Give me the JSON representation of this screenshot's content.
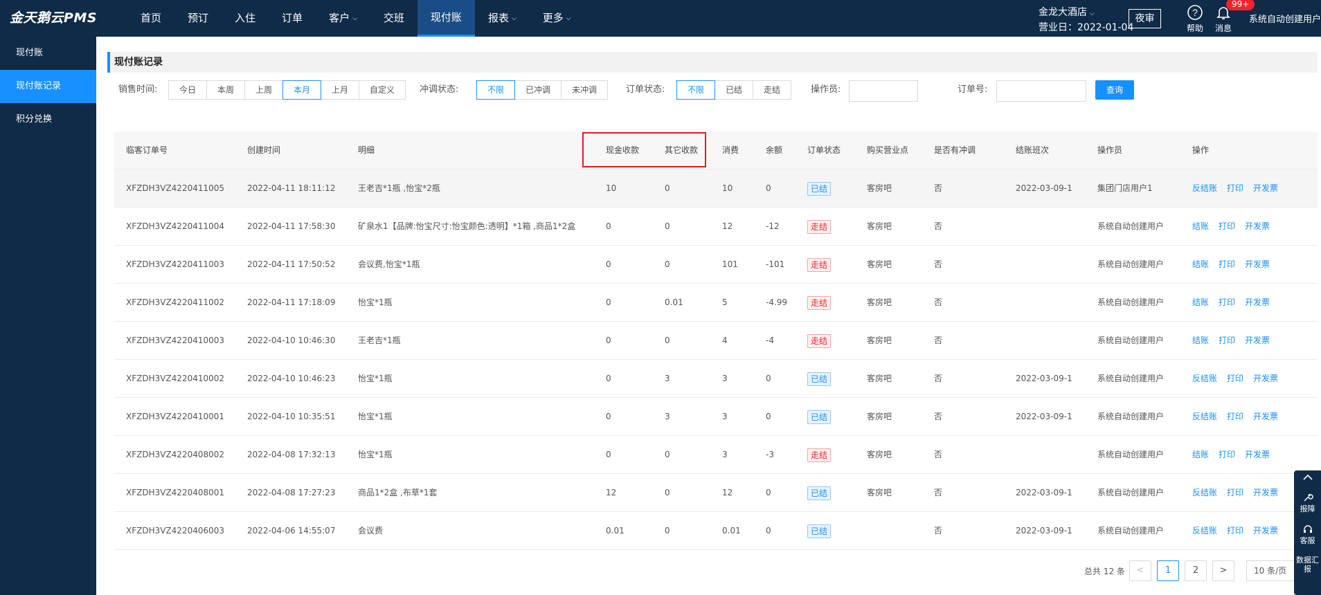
{
  "app": {
    "logo": "金天鹅云PMS",
    "nav": [
      {
        "label": "首页",
        "dropdown": false
      },
      {
        "label": "预订",
        "dropdown": false
      },
      {
        "label": "入住",
        "dropdown": false
      },
      {
        "label": "订单",
        "dropdown": false
      },
      {
        "label": "客户",
        "dropdown": true
      },
      {
        "label": "交班",
        "dropdown": false
      },
      {
        "label": "现付账",
        "dropdown": false,
        "active": true
      },
      {
        "label": "报表",
        "dropdown": true
      },
      {
        "label": "更多",
        "dropdown": true
      }
    ],
    "hotel_name": "金龙大酒店",
    "business_day": "营业日：2022-01-04",
    "night_audit": "夜审",
    "help_label": "帮助",
    "msg_label": "消息",
    "msg_badge": "99+",
    "user_name": "系统自动创建用户"
  },
  "sidebar": {
    "items": [
      {
        "label": "现付账",
        "active": false
      },
      {
        "label": "现付账记录",
        "active": true
      },
      {
        "label": "积分兑换",
        "active": false
      }
    ]
  },
  "page": {
    "title": "现付账记录",
    "filters": {
      "sale_time_label": "销售时间:",
      "sale_time_options": [
        "今日",
        "本周",
        "上周",
        "本月",
        "上月",
        "自定义"
      ],
      "sale_time_selected": "本月",
      "adjust_label": "冲调状态:",
      "adjust_options": [
        "不限",
        "已冲调",
        "未冲调"
      ],
      "adjust_selected": "不限",
      "order_status_label": "订单状态:",
      "order_status_options": [
        "不限",
        "已结",
        "走结"
      ],
      "order_status_selected": "不限",
      "operator_label": "操作员:",
      "operator_value": "",
      "order_no_label": "订单号:",
      "order_no_value": "",
      "query_button": "查询"
    },
    "table": {
      "headers": [
        "临客订单号",
        "创建时间",
        "明细",
        "现金收款",
        "其它收款",
        "消费",
        "余额",
        "订单状态",
        "购买营业点",
        "是否有冲调",
        "结账班次",
        "操作员",
        "操作"
      ],
      "rows": [
        {
          "order_no": "XFZDH3VZ4220411005",
          "created": "2022-04-11 18:11:12",
          "detail": "王老吉*1瓶 ,怡宝*2瓶",
          "cash": "10",
          "other": "0",
          "consume": "10",
          "balance": "0",
          "status": "已结",
          "status_type": "done",
          "point": "客房吧",
          "adjusted": "否",
          "shift": "2022-03-09-1",
          "operator": "集团门店用户1",
          "actions": [
            "反结账",
            "打印",
            "开发票"
          ]
        },
        {
          "order_no": "XFZDH3VZ4220411004",
          "created": "2022-04-11 17:58:30",
          "detail": "矿泉水1【品牌:怡宝尺寸:怡宝颜色:透明】*1箱 ,商品1*2盒",
          "cash": "0",
          "other": "0",
          "consume": "12",
          "balance": "-12",
          "status": "走结",
          "status_type": "skip",
          "point": "客房吧",
          "adjusted": "否",
          "shift": "",
          "operator": "系统自动创建用户",
          "actions": [
            "结账",
            "打印",
            "开发票"
          ]
        },
        {
          "order_no": "XFZDH3VZ4220411003",
          "created": "2022-04-11 17:50:52",
          "detail": "会议费,怡宝*1瓶",
          "cash": "0",
          "other": "0",
          "consume": "101",
          "balance": "-101",
          "status": "走结",
          "status_type": "skip",
          "point": "客房吧",
          "adjusted": "否",
          "shift": "",
          "operator": "系统自动创建用户",
          "actions": [
            "结账",
            "打印",
            "开发票"
          ]
        },
        {
          "order_no": "XFZDH3VZ4220411002",
          "created": "2022-04-11 17:18:09",
          "detail": "怡宝*1瓶",
          "cash": "0",
          "other": "0.01",
          "consume": "5",
          "balance": "-4.99",
          "status": "走结",
          "status_type": "skip",
          "point": "客房吧",
          "adjusted": "否",
          "shift": "",
          "operator": "系统自动创建用户",
          "actions": [
            "结账",
            "打印",
            "开发票"
          ]
        },
        {
          "order_no": "XFZDH3VZ4220410003",
          "created": "2022-04-10 10:46:30",
          "detail": "王老吉*1瓶",
          "cash": "0",
          "other": "0",
          "consume": "4",
          "balance": "-4",
          "status": "走结",
          "status_type": "skip",
          "point": "客房吧",
          "adjusted": "否",
          "shift": "",
          "operator": "系统自动创建用户",
          "actions": [
            "结账",
            "打印",
            "开发票"
          ]
        },
        {
          "order_no": "XFZDH3VZ4220410002",
          "created": "2022-04-10 10:46:23",
          "detail": "怡宝*1瓶",
          "cash": "0",
          "other": "3",
          "consume": "3",
          "balance": "0",
          "status": "已结",
          "status_type": "done",
          "point": "客房吧",
          "adjusted": "否",
          "shift": "2022-03-09-1",
          "operator": "系统自动创建用户",
          "actions": [
            "反结账",
            "打印",
            "开发票"
          ]
        },
        {
          "order_no": "XFZDH3VZ4220410001",
          "created": "2022-04-10 10:35:51",
          "detail": "怡宝*1瓶",
          "cash": "0",
          "other": "3",
          "consume": "3",
          "balance": "0",
          "status": "已结",
          "status_type": "done",
          "point": "客房吧",
          "adjusted": "否",
          "shift": "2022-03-09-1",
          "operator": "系统自动创建用户",
          "actions": [
            "反结账",
            "打印",
            "开发票"
          ]
        },
        {
          "order_no": "XFZDH3VZ4220408002",
          "created": "2022-04-08 17:32:13",
          "detail": "怡宝*1瓶",
          "cash": "0",
          "other": "0",
          "consume": "3",
          "balance": "-3",
          "status": "走结",
          "status_type": "skip",
          "point": "客房吧",
          "adjusted": "否",
          "shift": "",
          "operator": "系统自动创建用户",
          "actions": [
            "结账",
            "打印",
            "开发票"
          ]
        },
        {
          "order_no": "XFZDH3VZ4220408001",
          "created": "2022-04-08 17:27:23",
          "detail": "商品1*2盒 ,布草*1套",
          "cash": "12",
          "other": "0",
          "consume": "12",
          "balance": "0",
          "status": "已结",
          "status_type": "done",
          "point": "客房吧",
          "adjusted": "否",
          "shift": "2022-03-09-1",
          "operator": "系统自动创建用户",
          "actions": [
            "反结账",
            "打印",
            "开发票"
          ]
        },
        {
          "order_no": "XFZDH3VZ4220406003",
          "created": "2022-04-06 14:55:07",
          "detail": "会议费",
          "cash": "0.01",
          "other": "0",
          "consume": "0.01",
          "balance": "0",
          "status": "已结",
          "status_type": "done",
          "point": "",
          "adjusted": "否",
          "shift": "2022-03-09-1",
          "operator": "系统自动创建用户",
          "actions": [
            "反结账",
            "打印",
            "开发票"
          ]
        }
      ]
    },
    "pager": {
      "total": "总共 12 条",
      "prev": "<",
      "pages": [
        "1",
        "2"
      ],
      "current": "1",
      "next": ">",
      "size": "10 条/页"
    }
  },
  "float_toolbar": {
    "items": [
      {
        "label": "报障",
        "icon": "wrench-icon"
      },
      {
        "label": "客服",
        "icon": "headset-icon"
      },
      {
        "label": "数据汇报",
        "icon": "report-icon"
      }
    ]
  }
}
